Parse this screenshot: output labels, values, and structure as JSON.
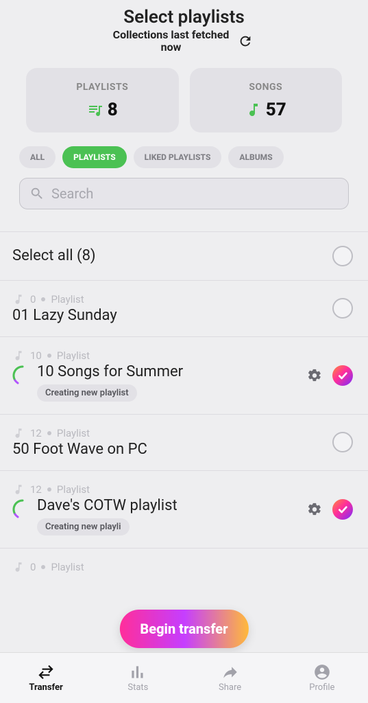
{
  "header": {
    "title": "Select playlists",
    "fetch_line1": "Collections last fetched",
    "fetch_line2": "now"
  },
  "stats": {
    "playlists": {
      "label": "PLAYLISTS",
      "value": "8"
    },
    "songs": {
      "label": "SONGS",
      "value": "57"
    }
  },
  "filters": {
    "all": "ALL",
    "playlists": "PLAYLISTS",
    "liked": "LIKED PLAYLISTS",
    "albums": "ALBUMS",
    "active": "playlists"
  },
  "search": {
    "placeholder": "Search"
  },
  "select_all": {
    "label": "Select all (8)"
  },
  "items": [
    {
      "count": "0",
      "type": "Playlist",
      "title": "01 Lazy Sunday",
      "status": "",
      "selected": false,
      "working": false
    },
    {
      "count": "10",
      "type": "Playlist",
      "title": "10 Songs for Summer",
      "status": "Creating new playlist",
      "selected": true,
      "working": true
    },
    {
      "count": "12",
      "type": "Playlist",
      "title": "50 Foot Wave on PC",
      "status": "",
      "selected": false,
      "working": false
    },
    {
      "count": "12",
      "type": "Playlist",
      "title": "Dave's COTW playlist",
      "status": "Creating new playli",
      "selected": true,
      "working": true
    },
    {
      "count": "0",
      "type": "Playlist",
      "title": "",
      "status": "",
      "selected": false,
      "working": false
    }
  ],
  "begin_button": "Begin transfer",
  "tabbar": {
    "transfer": "Transfer",
    "stats": "Stats",
    "share": "Share",
    "profile": "Profile",
    "active": "transfer"
  }
}
